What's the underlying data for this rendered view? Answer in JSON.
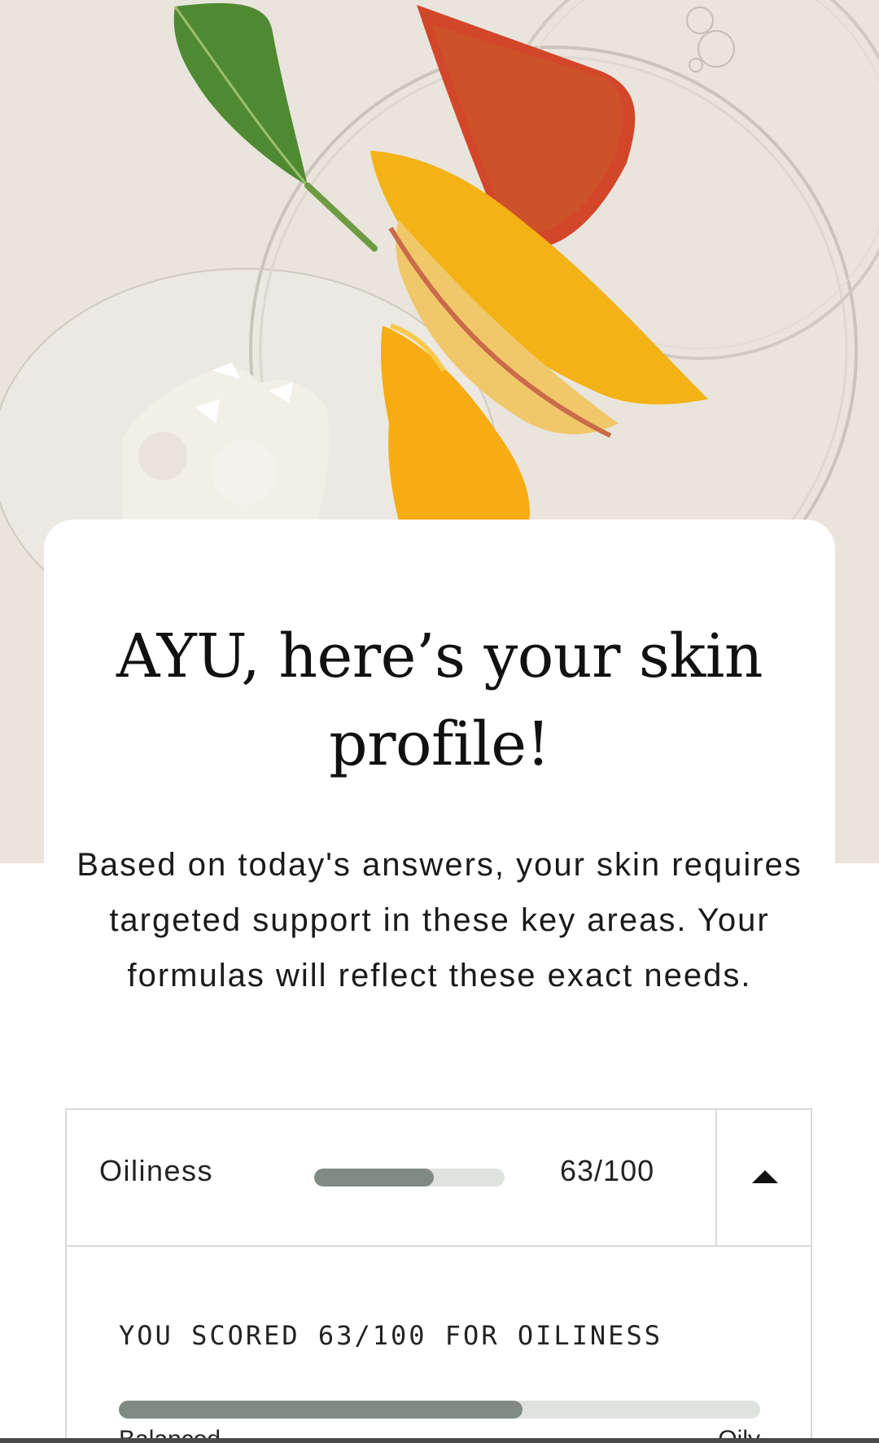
{
  "hero": {
    "image_description_icon": "mango-leaf-petri-dish-hero-image"
  },
  "card": {
    "title": "AYU, here’s your skin profile!",
    "intro": "Based on today's answers, your skin requires targeted support in these key areas. Your formulas will reflect these exact needs."
  },
  "profile": {
    "row": {
      "label": "Oiliness",
      "score_text": "63/100",
      "score_value": 63,
      "score_max": 100,
      "toggle_icon": "caret-up-icon",
      "expanded": true
    },
    "detail": {
      "heading": "YOU SCORED 63/100 FOR OILINESS",
      "scale_left": "Balanced",
      "scale_right": "Oily"
    }
  },
  "colors": {
    "hero_background": "#e9e5dc",
    "bar_fill": "#7e8a82",
    "bar_track": "#dfe3df",
    "border": "#d9d9d9"
  }
}
